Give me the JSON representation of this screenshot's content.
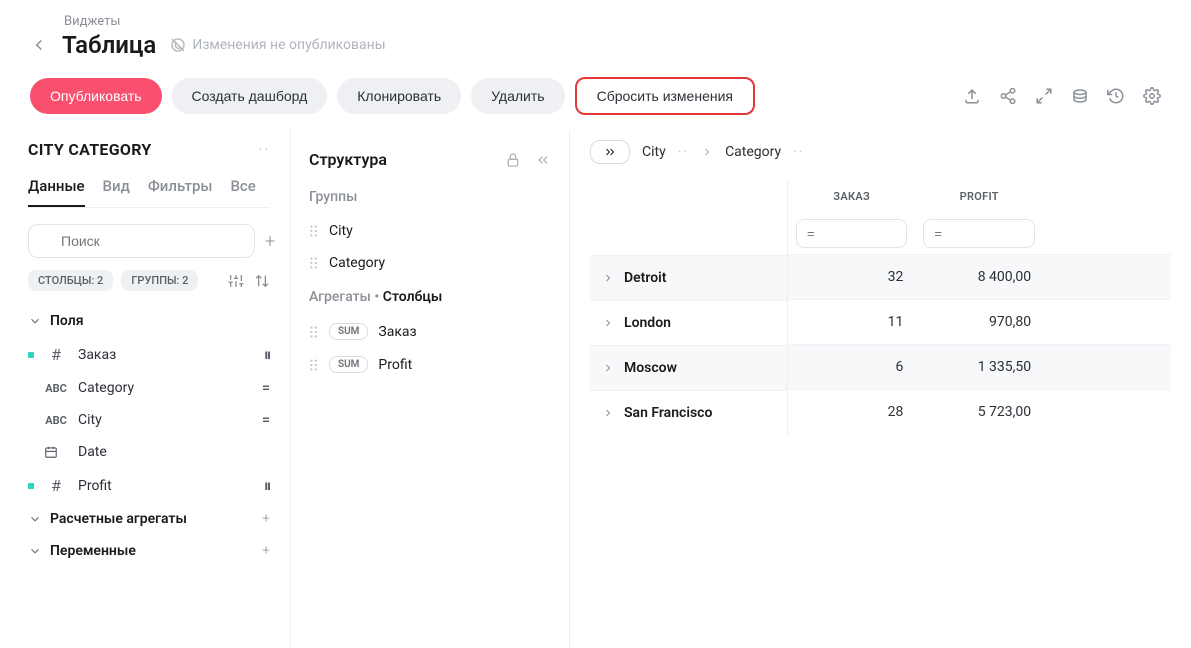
{
  "breadcrumb": {
    "parent": "Виджеты"
  },
  "header": {
    "title": "Таблица",
    "unpublished_label": "Изменения не опубликованы"
  },
  "actions": {
    "publish": "Опубликовать",
    "create_dashboard": "Создать дашборд",
    "clone": "Клонировать",
    "delete": "Удалить",
    "reset": "Сбросить изменения"
  },
  "left": {
    "dataset_title": "CITY CATEGORY",
    "tabs": {
      "data": "Данные",
      "view": "Вид",
      "filters": "Фильтры",
      "all": "Все"
    },
    "search_placeholder": "Поиск",
    "chips": {
      "columns": "СТОЛБЦЫ: 2",
      "groups": "ГРУППЫ: 2"
    },
    "sections": {
      "fields": "Поля",
      "calc_aggregates": "Расчетные агрегаты",
      "variables": "Переменные"
    },
    "fields": [
      {
        "active": true,
        "type": "#",
        "name": "Заказ",
        "action": "pause"
      },
      {
        "active": false,
        "type": "ABC",
        "name": "Category",
        "action": "eq"
      },
      {
        "active": false,
        "type": "ABC",
        "name": "City",
        "action": "eq"
      },
      {
        "active": false,
        "type": "cal",
        "name": "Date",
        "action": ""
      },
      {
        "active": true,
        "type": "#",
        "name": "Profit",
        "action": "pause"
      }
    ]
  },
  "mid": {
    "title": "Структура",
    "groups_label": "Группы",
    "groups": [
      "City",
      "Category"
    ],
    "aggregates_label": "Агрегаты",
    "columns_label": "Столбцы",
    "aggregates": [
      {
        "fn": "SUM",
        "name": "Заказ"
      },
      {
        "fn": "SUM",
        "name": "Profit"
      }
    ]
  },
  "right": {
    "crumbs": {
      "a": "City",
      "b": "Category"
    },
    "columns": {
      "c1": "ЗАКАЗ",
      "c2": "PROFIT"
    },
    "filter_placeholder": "=",
    "rows": [
      {
        "name": "Detroit",
        "c1": "32",
        "c2": "8 400,00"
      },
      {
        "name": "London",
        "c1": "11",
        "c2": "970,80"
      },
      {
        "name": "Moscow",
        "c1": "6",
        "c2": "1 335,50"
      },
      {
        "name": "San Francisco",
        "c1": "28",
        "c2": "5 723,00"
      }
    ]
  }
}
